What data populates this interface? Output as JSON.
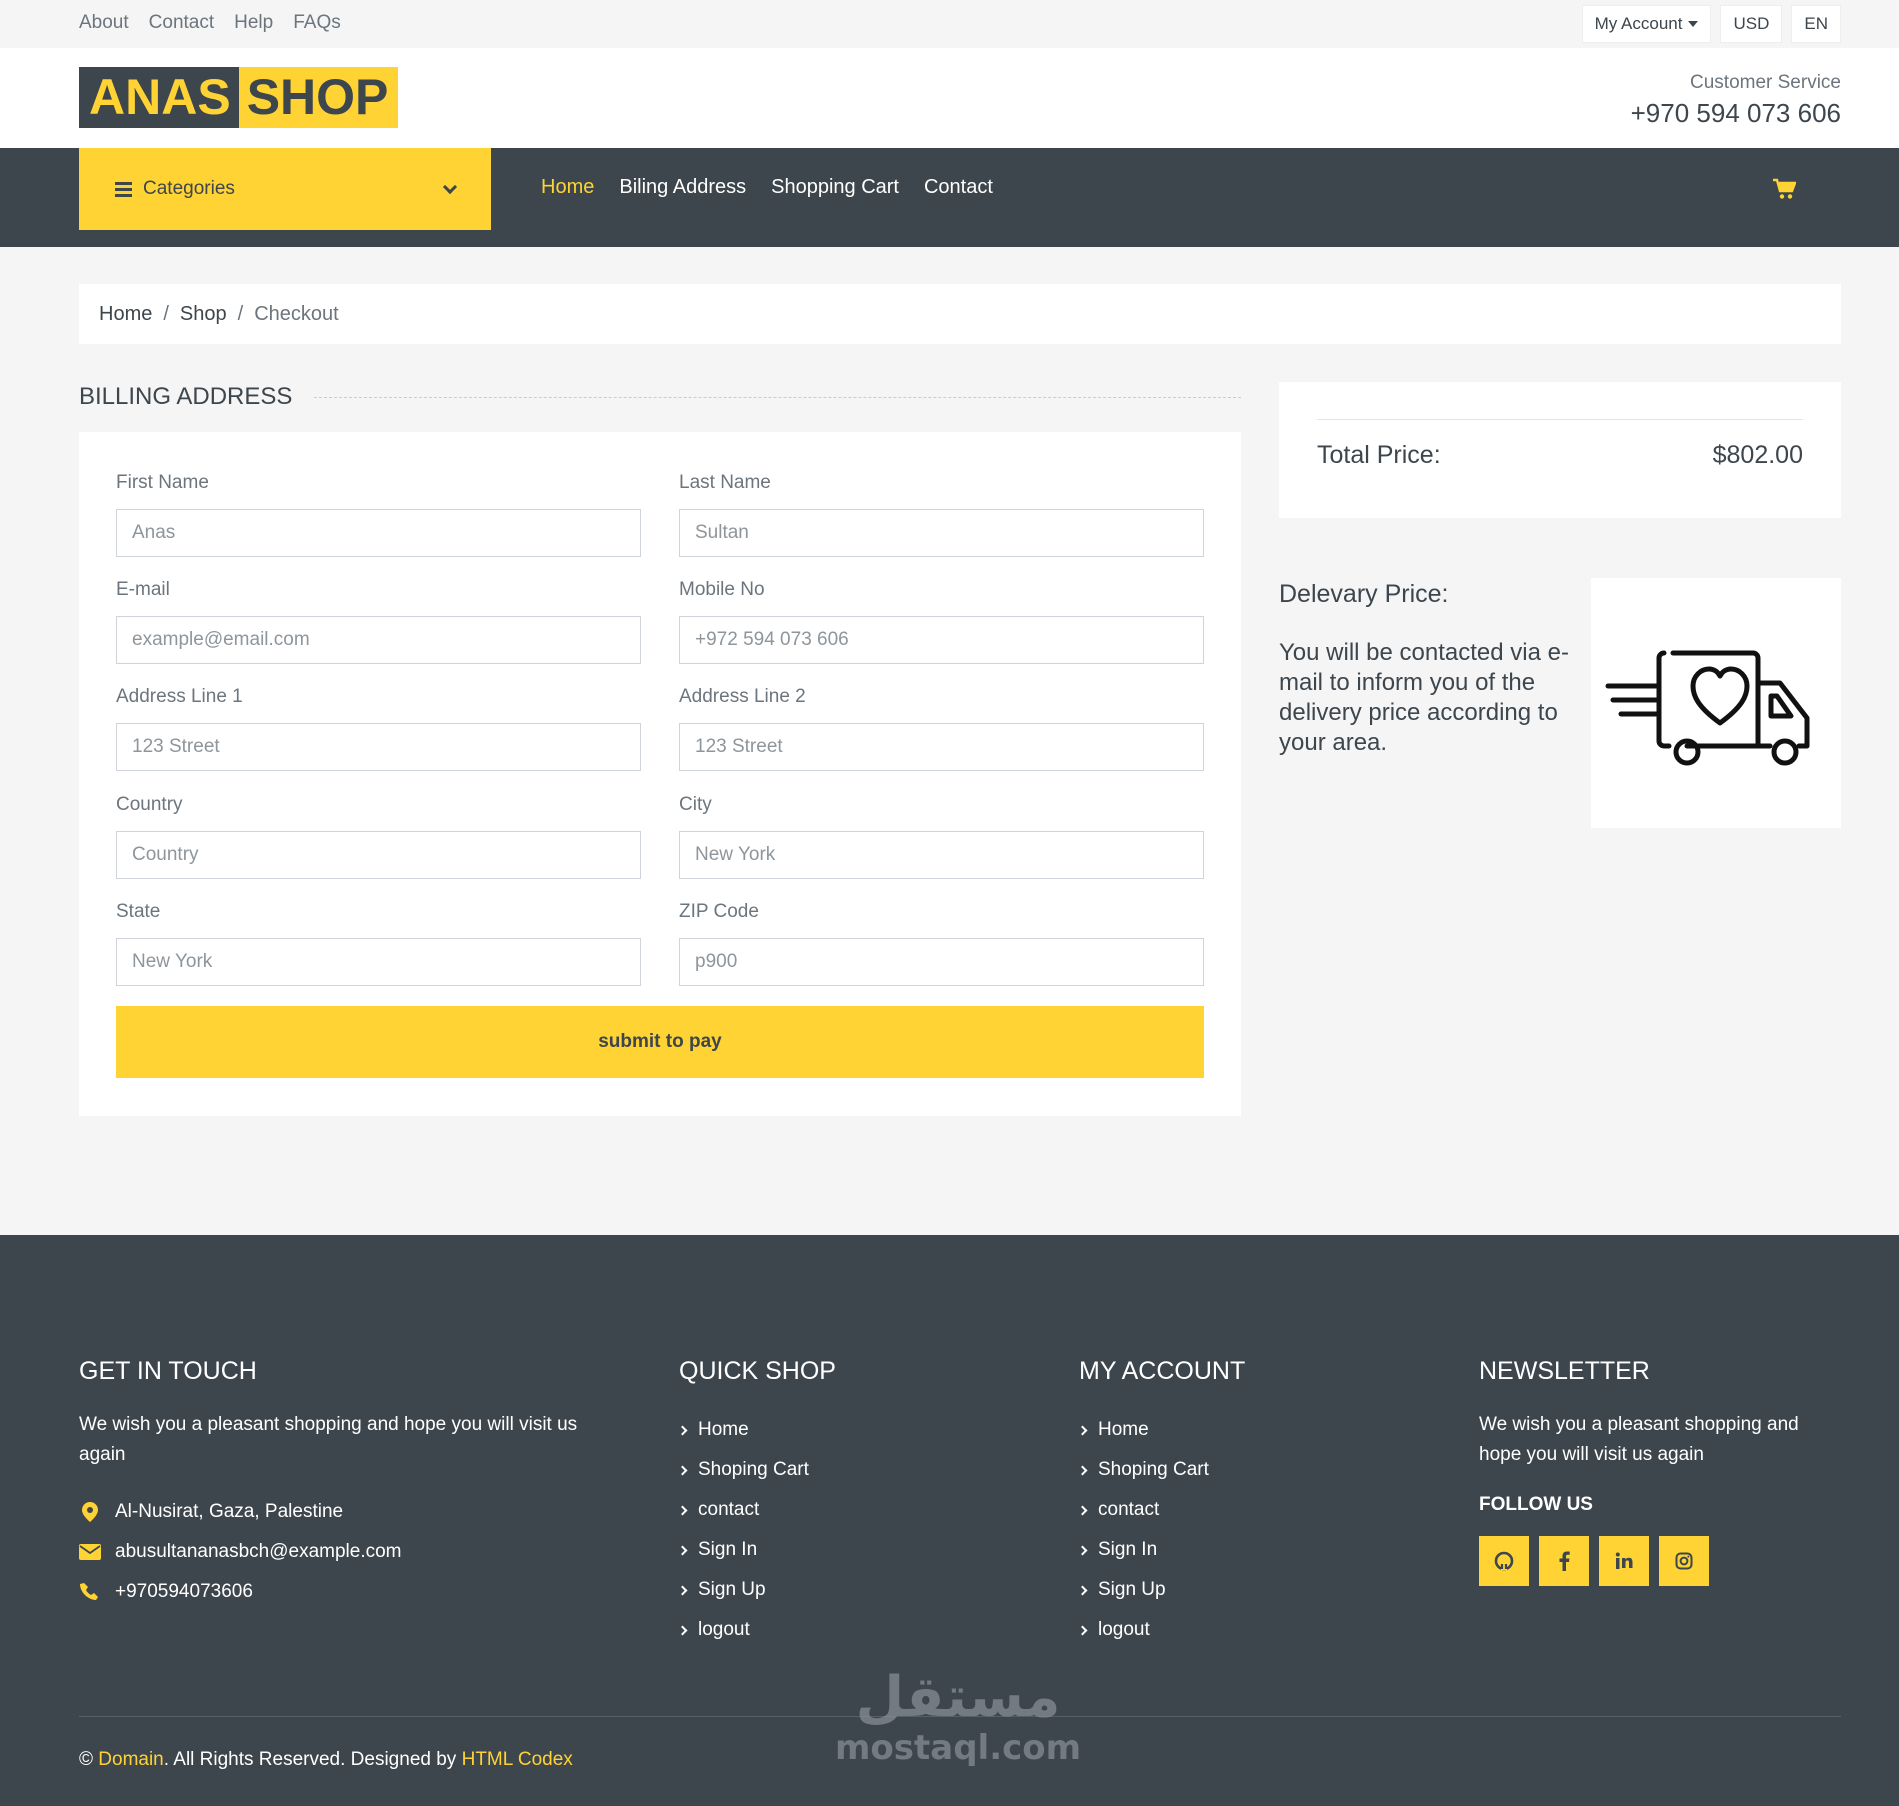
{
  "topbar": {
    "links": [
      "About",
      "Contact",
      "Help",
      "FAQs"
    ],
    "account_label": "My Account",
    "currency_label": "USD",
    "language_label": "EN"
  },
  "header": {
    "logo_part1": "ANAS",
    "logo_part2": "SHOP",
    "service_title": "Customer Service",
    "service_phone": "+970 594 073 606"
  },
  "nav": {
    "categories_label": "Categories",
    "links": [
      "Home",
      "Biling Address",
      "Shopping Cart",
      "Contact"
    ]
  },
  "breadcrumb": {
    "home": "Home",
    "shop": "Shop",
    "current": "Checkout"
  },
  "billing": {
    "title": "Billing Address",
    "fields": [
      {
        "label": "First Name",
        "placeholder": "Anas"
      },
      {
        "label": "Last Name",
        "placeholder": "Sultan"
      },
      {
        "label": "E-mail",
        "placeholder": "example@email.com"
      },
      {
        "label": "Mobile No",
        "placeholder": "+972 594 073 606"
      },
      {
        "label": "Address Line 1",
        "placeholder": "123 Street"
      },
      {
        "label": "Address Line 2",
        "placeholder": "123 Street"
      },
      {
        "label": "Country",
        "placeholder": "Country"
      },
      {
        "label": "City",
        "placeholder": "New York"
      },
      {
        "label": "State",
        "placeholder": "New York"
      },
      {
        "label": "ZIP Code",
        "placeholder": "p900"
      }
    ],
    "submit_label": "submit to pay"
  },
  "summary": {
    "total_label": "Total Price:",
    "total_value": "$802.00",
    "delivery_title": "Delevary Price:",
    "delivery_text": "You will be contacted via e-mail to inform you of the delivery price according to your area."
  },
  "footer": {
    "touch": {
      "title": "Get In Touch",
      "text": "We wish you a pleasant shopping and hope you will visit us again",
      "address": "Al-Nusirat, Gaza, Palestine",
      "email": "abusultananasbch@example.com",
      "phone": "+970594073606"
    },
    "quick_shop": {
      "title": "Quick Shop",
      "links": [
        "Home",
        "Shoping Cart",
        "contact",
        "Sign In",
        "Sign Up",
        "logout"
      ]
    },
    "my_account": {
      "title": "My Account",
      "links": [
        "Home",
        "Shoping Cart",
        "contact",
        "Sign In",
        "Sign Up",
        "logout"
      ]
    },
    "newsletter": {
      "title": "Newsletter",
      "text": "We wish you a pleasant shopping and hope you will visit us again",
      "follow_label": "FOLLOW US",
      "socials": [
        "github-icon",
        "facebook-icon",
        "linkedin-icon",
        "instagram-icon"
      ]
    },
    "copyright": {
      "prefix": "©",
      "domain": "Domain",
      "middle": ". All Rights Reserved. Designed by",
      "designer": "HTML Codex"
    }
  },
  "watermark": {
    "arabic": "مستقل",
    "latin": "mostaql.com"
  },
  "colors": {
    "accent": "#ffd333",
    "dark": "#3d464d",
    "muted": "#6c757d",
    "background": "#f5f5f5"
  }
}
